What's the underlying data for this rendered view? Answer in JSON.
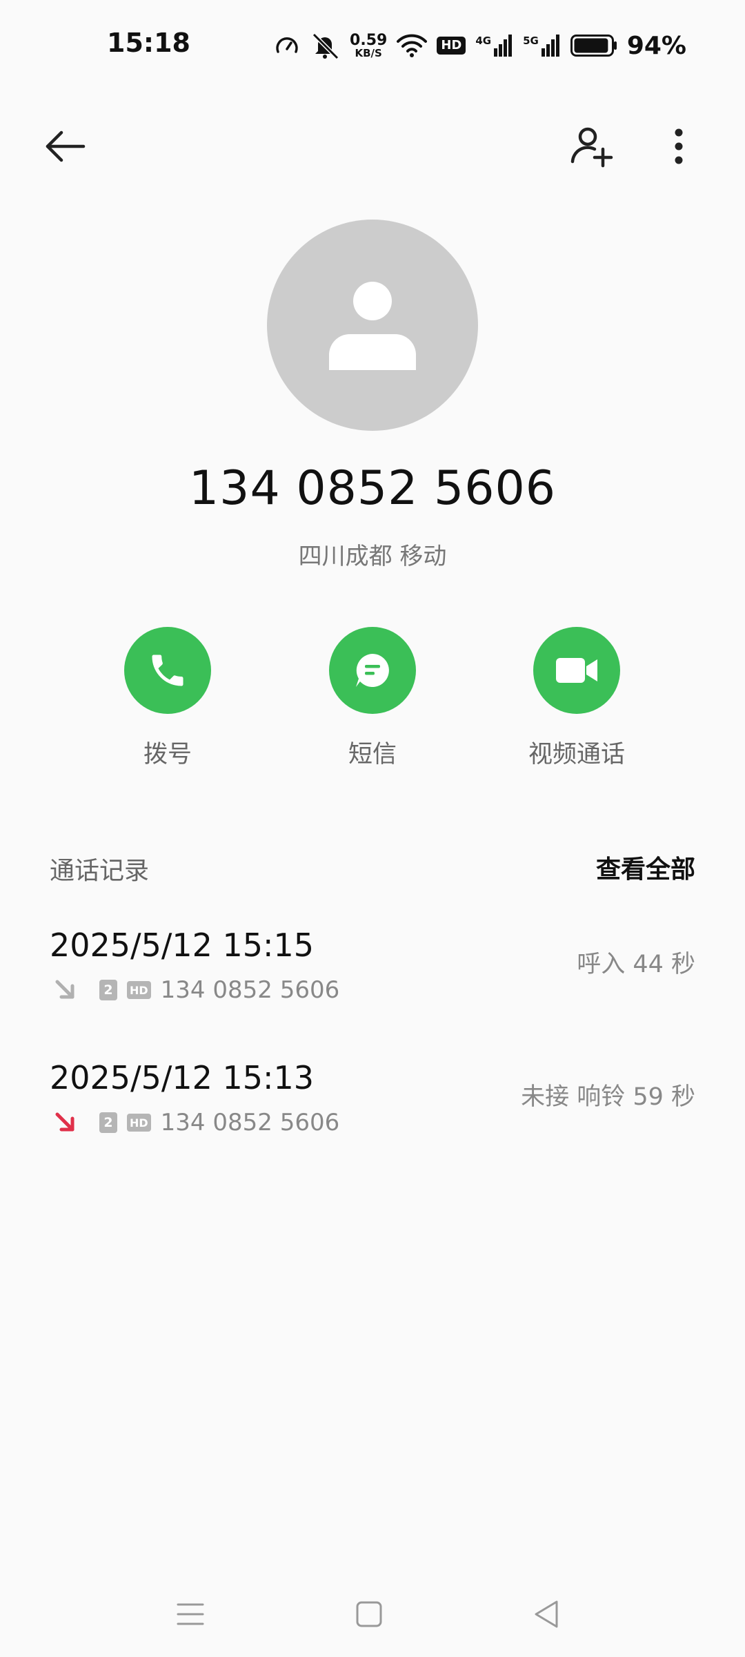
{
  "status_bar": {
    "time": "15:18",
    "net_speed_value": "0.59",
    "net_speed_unit": "KB/S",
    "hd_label": "HD",
    "network_1": "4G",
    "network_2": "5G",
    "battery_percent": "94%",
    "battery_level": 0.94
  },
  "top_bar": {
    "back_icon": "arrow-left-icon",
    "add_contact_icon": "person-add-icon",
    "more_icon": "more-vertical-icon"
  },
  "contact": {
    "number": "134 0852 5606",
    "location": "四川成都 移动"
  },
  "actions": [
    {
      "label": "拨号",
      "icon": "phone-icon"
    },
    {
      "label": "短信",
      "icon": "message-icon"
    },
    {
      "label": "视频通话",
      "icon": "video-icon"
    }
  ],
  "call_log": {
    "title": "通话记录",
    "view_all": "查看全部",
    "entries": [
      {
        "date": "2025/5/12 15:15",
        "sim": "2",
        "hd": "HD",
        "number": "134 0852 5606",
        "status": "呼入  44 秒",
        "direction": "incoming",
        "arrow_color": "#b0b0b0"
      },
      {
        "date": "2025/5/12 15:13",
        "sim": "2",
        "hd": "HD",
        "number": "134 0852 5606",
        "status": "未接  响铃 59 秒",
        "direction": "missed",
        "arrow_color": "#e0304a"
      }
    ]
  },
  "colors": {
    "accent_green": "#3bbf57",
    "missed_red": "#e0304a",
    "background": "#fafafa"
  }
}
